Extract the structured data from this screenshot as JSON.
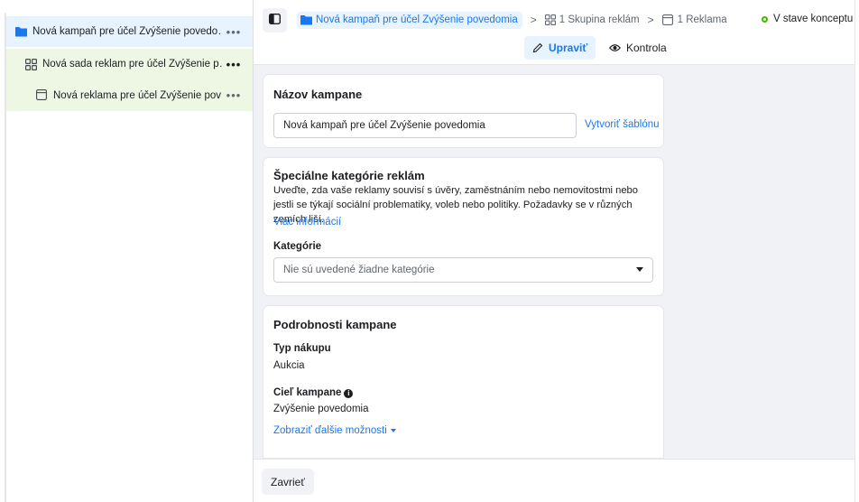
{
  "outline": {
    "campaign": {
      "label": "Nová kampaň pre účel Zvýšenie povedo…",
      "more": "•••"
    },
    "adset": {
      "label": "Nová sada reklam pre účel Zvýšenie p…",
      "more": "•••"
    },
    "ad": {
      "label": "Nová reklama pre účel Zvýšenie pov…",
      "more": "•••"
    }
  },
  "breadcrumb": {
    "campaign": "Nová kampaň pre účel Zvýšenie povedomia",
    "adset": "1 Skupina reklám",
    "ad": "1 Reklama",
    "separator": ">"
  },
  "status": {
    "label": "V stave konceptu",
    "color": "#44b700"
  },
  "toolbar": {
    "edit_label": "Upraviť",
    "review_label": "Kontrola"
  },
  "campaign_name": {
    "title": "Názov kampane",
    "value": "Nová kampaň pre účel Zvýšenie povedomia",
    "template_link": "Vytvoriť šablónu"
  },
  "special_categories": {
    "title": "Špeciálne kategórie reklám",
    "description": "Uveďte, zda vaše reklamy souvisí s úvěry, zaměstnáním nebo nemovitostmi nebo jestli se týkají sociální problematiky, voleb nebo politiky. Požadavky se v různých zemích liší.",
    "more_info": "Viac informácií",
    "category_label": "Kategórie",
    "category_placeholder": "Nie sú uvedené žiadne kategórie"
  },
  "details": {
    "title": "Podrobnosti kampane",
    "purchase_type_label": "Typ nákupu",
    "purchase_type_value": "Aukcia",
    "objective_label": "Cieľ kampane",
    "objective_value": "Zvýšenie povedomia",
    "show_more": "Zobraziť ďalšie možnosti"
  },
  "footer": {
    "close_label": "Zavrieť"
  },
  "colors": {
    "accent": "#1877f2",
    "selected_bg": "#e7f3ff",
    "child_bg": "#eef6e4"
  }
}
